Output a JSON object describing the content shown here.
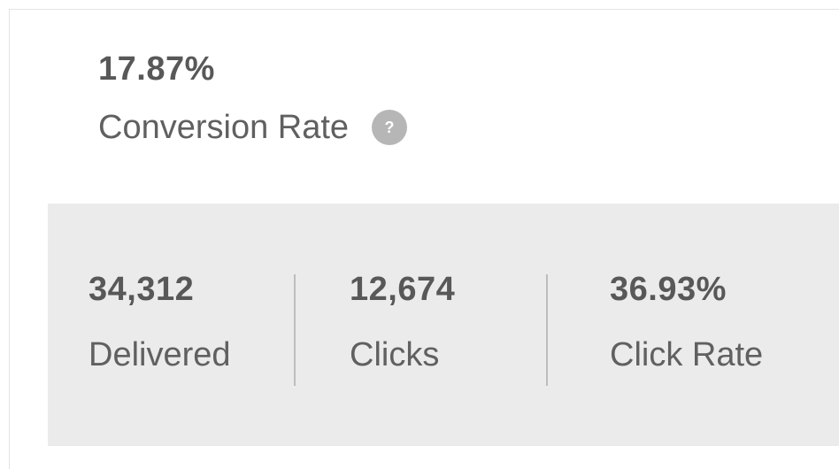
{
  "conversion": {
    "value": "17.87%",
    "label": "Conversion Rate",
    "help_icon_glyph": "?"
  },
  "stats": {
    "delivered": {
      "value": "34,312",
      "label": "Delivered"
    },
    "clicks": {
      "value": "12,674",
      "label": "Clicks"
    },
    "click_rate": {
      "value": "36.93%",
      "label": "Click Rate"
    }
  },
  "colors": {
    "text": "#5f5f5f",
    "panel_bg": "#ebebeb",
    "help_icon_bg": "#b6b6b6",
    "divider": "#bdbdbd"
  },
  "icons": {
    "help": "help-icon"
  }
}
